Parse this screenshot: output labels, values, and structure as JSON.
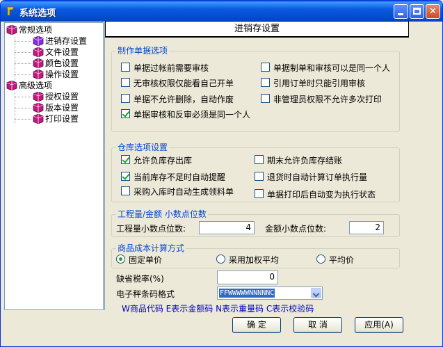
{
  "window": {
    "title": "系统选项"
  },
  "tree": {
    "groups": [
      {
        "label": "常规选项",
        "items": [
          "进销存设置",
          "文件设置",
          "颜色设置",
          "操作设置"
        ]
      },
      {
        "label": "高级选项",
        "items": [
          "授权设置",
          "版本设置",
          "打印设置"
        ]
      }
    ]
  },
  "panel": {
    "header": "进销存设置"
  },
  "doc_options": {
    "title": "制作单据选项",
    "left": [
      {
        "label": "单据过帐前需要审核",
        "checked": false
      },
      {
        "label": "无审核权限仅能看自己开单",
        "checked": false
      },
      {
        "label": "单据不允许删除，自动作废",
        "checked": false
      },
      {
        "label": "单据审核和反审必须是同一个人",
        "checked": true
      }
    ],
    "right": [
      {
        "label": "单据制单和审核可以是同一个人",
        "checked": false
      },
      {
        "label": "引用订单时只能引用审核",
        "checked": false
      },
      {
        "label": "非管理员权限不允许多次打印",
        "checked": false
      }
    ]
  },
  "warehouse": {
    "title": "仓库选项设置",
    "left": [
      {
        "label": "允许负库存出库",
        "checked": true
      },
      {
        "label": "当前库存不足时自动提醒",
        "checked": true
      },
      {
        "label": "采购入库时自动生成领料单",
        "checked": false
      }
    ],
    "right": [
      {
        "label": "期末允许负库存结账",
        "checked": false
      },
      {
        "label": "退货时自动计算订单执行量",
        "checked": false
      },
      {
        "label": "单据打印后自动变为执行状态",
        "checked": false
      }
    ]
  },
  "decimals": {
    "title": "工程量/金额 小数点位数",
    "qty_label": "工程量小数点位数:",
    "qty_value": "4",
    "amount_label": "金额小数点位数:",
    "amount_value": "2"
  },
  "cost": {
    "title": "商品成本计算方式",
    "options": [
      {
        "label": "固定单价",
        "selected": true
      },
      {
        "label": "采用加权平均",
        "selected": false
      },
      {
        "label": "平均价",
        "selected": false
      }
    ]
  },
  "tax": {
    "label": "缺省税率(%)",
    "value": "0"
  },
  "barcode": {
    "label": "电子秤条码格式",
    "value": "FFWWWWWNNNNNC",
    "legend": "W商品代码 E表示金额码 N表示重量码 C表示校验码"
  },
  "buttons": {
    "ok": "确 定",
    "cancel": "取 消",
    "apply": "应用(A)"
  },
  "colors": {
    "titlebar": "#0a5ae0",
    "group_title": "#0046d5",
    "legend": "#0000c0",
    "check": "#21a121"
  }
}
